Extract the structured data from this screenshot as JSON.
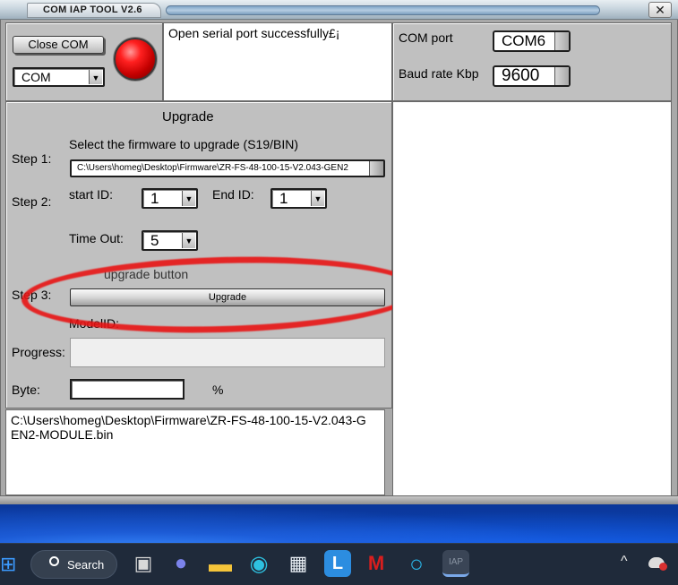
{
  "window": {
    "title": "COM IAP TOOL V2.6",
    "close_glyph": "✕"
  },
  "connection": {
    "close_button_label": "Close COM",
    "port_type_value": "COM",
    "status_message": "Open serial port successfully£¡",
    "com_port_label": "COM port",
    "com_port_value": "COM6",
    "baud_label": "Baud rate Kbp",
    "baud_value": "9600",
    "led_color": "#e00000"
  },
  "upgrade": {
    "heading": "Upgrade",
    "select_text": "Select the firmware  to upgrade (S19/BIN)",
    "step1": "Step 1:",
    "firmware_path": "C:\\Users\\homeg\\Desktop\\Firmware\\ZR-FS-48-100-15-V2.043-GEN2",
    "step2": "Step 2:",
    "start_id_label": "start ID:",
    "start_id_value": "1",
    "end_id_label": "End ID:",
    "end_id_value": "1",
    "timeout_label": "Time Out:",
    "timeout_value": "5",
    "step3": "Step 3:",
    "hint_text": "upgrade button",
    "upgrade_button": "Upgrade",
    "modelid_label": "ModelID:",
    "progress_label": "Progress:",
    "byte_label": "Byte:",
    "percent_sign": "%",
    "log_text": "C:\\Users\\homeg\\Desktop\\Firmware\\ZR-FS-48-100-15-V2.043-GEN2-MODULE.bin"
  },
  "taskbar": {
    "search_label": "Search",
    "items": [
      {
        "name": "windows-start-icon",
        "glyph": "⊞"
      },
      {
        "name": "task-view-icon",
        "glyph": "▣"
      },
      {
        "name": "teams-icon",
        "glyph": "●"
      },
      {
        "name": "file-explorer-icon",
        "glyph": "▬"
      },
      {
        "name": "edge-icon",
        "glyph": "◉"
      },
      {
        "name": "store-icon",
        "glyph": "▦"
      },
      {
        "name": "l-app-icon",
        "glyph": "L"
      },
      {
        "name": "mcafee-icon",
        "glyph": "M"
      },
      {
        "name": "cortana-icon",
        "glyph": "○"
      },
      {
        "name": "iap-tool-icon",
        "glyph": "IAP"
      }
    ],
    "tray_glyph": "^"
  },
  "colors": {
    "window_gray": "#c0c0c0",
    "highlight_red": "#e81414",
    "taskbar": "#1f2a3a"
  }
}
